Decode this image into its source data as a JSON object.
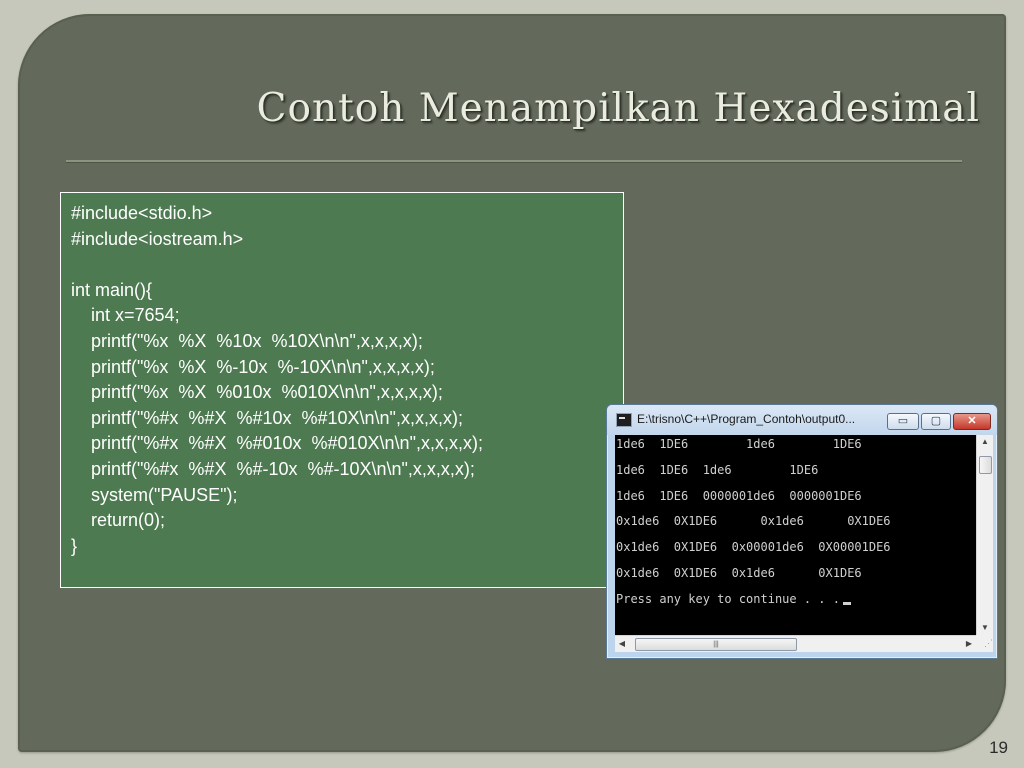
{
  "slide": {
    "title": "Contoh Menampilkan Hexadesimal",
    "page_number": "19"
  },
  "code": {
    "lines": [
      "#include<stdio.h>",
      "#include<iostream.h>",
      "",
      "int main(){",
      "    int x=7654;",
      "    printf(\"%x  %X  %10x  %10X\\n\\n\",x,x,x,x);",
      "    printf(\"%x  %X  %-10x  %-10X\\n\\n\",x,x,x,x);",
      "    printf(\"%x  %X  %010x  %010X\\n\\n\",x,x,x,x);",
      "    printf(\"%#x  %#X  %#10x  %#10X\\n\\n\",x,x,x,x);",
      "    printf(\"%#x  %#X  %#010x  %#010X\\n\\n\",x,x,x,x);",
      "    printf(\"%#x  %#X  %#-10x  %#-10X\\n\\n\",x,x,x,x);",
      "    system(\"PAUSE\");",
      "    return(0);",
      "}"
    ]
  },
  "console": {
    "window_title": "E:\\trisno\\C++\\Program_Contoh\\output0...",
    "buttons": {
      "minimize": "▭",
      "maximize": "▢",
      "close": "✕"
    },
    "lines": [
      "1de6  1DE6        1de6        1DE6",
      "1de6  1DE6  1de6        1DE6",
      "1de6  1DE6  0000001de6  0000001DE6",
      "0x1de6  0X1DE6      0x1de6      0X1DE6",
      "0x1de6  0X1DE6  0x00001de6  0X00001DE6",
      "0x1de6  0X1DE6  0x1de6      0X1DE6",
      "Press any key to continue . . ."
    ],
    "icons": {
      "app": "console-app-icon",
      "scroll_up": "▲",
      "scroll_down": "▼",
      "scroll_left": "◀",
      "scroll_right": "▶",
      "thumb_grip": "|||",
      "resize": "⋰"
    }
  },
  "colors": {
    "background": "#c6c8bb",
    "panel": "#636a5b",
    "title": "#e9ecdf",
    "code_box": "#4d7a50",
    "console_bg": "#000000",
    "console_text": "#d0d0d0"
  }
}
